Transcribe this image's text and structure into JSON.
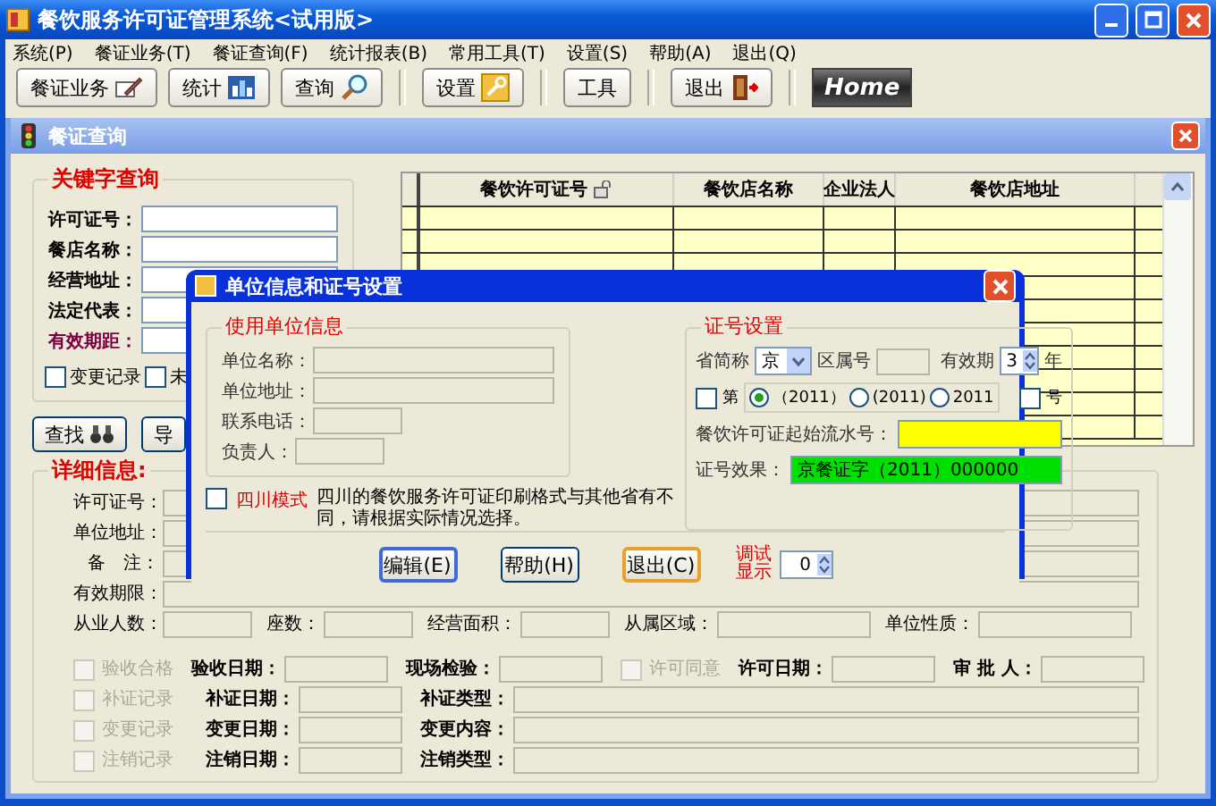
{
  "window": {
    "title": "餐饮服务许可证管理系统<试用版>"
  },
  "menu": [
    "系统(P)",
    "餐证业务(T)",
    "餐证查询(F)",
    "统计报表(B)",
    "常用工具(T)",
    "设置(S)",
    "帮助(A)",
    "退出(Q)"
  ],
  "toolbar": [
    {
      "label": "餐证业务",
      "kind": "edit"
    },
    {
      "label": "统计",
      "kind": "chart"
    },
    {
      "label": "查询",
      "kind": "search"
    },
    {
      "label": "设置",
      "kind": "settings"
    },
    {
      "label": "工具",
      "kind": "plain"
    },
    {
      "label": "退出",
      "kind": "exit"
    },
    {
      "label": "Home",
      "kind": "logo"
    }
  ],
  "query_window": {
    "title": "餐证查询",
    "keyword_group": {
      "title": "关键字查询",
      "fields": [
        {
          "label": "许可证号：",
          "kind": "normal"
        },
        {
          "label": "餐店名称：",
          "kind": "normal"
        },
        {
          "label": "经营地址：",
          "kind": "normal"
        },
        {
          "label": "法定代表：",
          "kind": "normal"
        },
        {
          "label": "有效期距：",
          "kind": "accent"
        }
      ],
      "checkboxes": [
        {
          "label": "变更记录",
          "checked": false
        },
        {
          "label": "未",
          "checked": false
        }
      ],
      "buttons": [
        {
          "label": "查找",
          "kind": "find"
        },
        {
          "label": "导",
          "kind": "plain"
        }
      ]
    },
    "results_table": {
      "columns": [
        {
          "label": "餐饮许可证号",
          "kind": "icon"
        },
        {
          "label": "餐饮店名称",
          "kind": "plain"
        },
        {
          "label": "企业法人",
          "kind": "plain"
        },
        {
          "label": "餐饮店地址",
          "kind": "plain"
        }
      ]
    },
    "detail_group": {
      "title": "详细信息:",
      "rows": [
        {
          "fields": [
            {
              "label": "许可证号：",
              "kind": "wide"
            }
          ]
        },
        {
          "fields": [
            {
              "label": "单位地址：",
              "kind": "wide"
            }
          ]
        },
        {
          "fields": [
            {
              "label": "备　注：",
              "kind": "wide"
            }
          ]
        },
        {
          "fields": [
            {
              "label": "有效期限：",
              "kind": "wide"
            }
          ]
        },
        {
          "fields": [
            {
              "label": "从业人数：",
              "kind": "small"
            },
            {
              "label": "座数：",
              "kind": "small"
            },
            {
              "label": "经营面积：",
              "kind": "small"
            },
            {
              "label": "从属区域：",
              "kind": "medium"
            },
            {
              "label": "单位性质：",
              "kind": "medium"
            }
          ]
        }
      ],
      "record_rows": [
        {
          "items": [
            {
              "kind": "checkbox",
              "label": "验收合格",
              "checked": false,
              "disabled": true
            },
            {
              "kind": "field",
              "label": "验收日期："
            },
            {
              "kind": "field",
              "label": "现场检验："
            },
            {
              "kind": "checkbox",
              "label": "许可同意",
              "checked": false,
              "disabled": true
            },
            {
              "kind": "field",
              "label": "许可日期："
            },
            {
              "kind": "field",
              "label": "审 批 人："
            }
          ]
        },
        {
          "items": [
            {
              "kind": "checkbox",
              "label": "补证记录",
              "checked": false,
              "disabled": true
            },
            {
              "kind": "field",
              "label": "补证日期："
            },
            {
              "kind": "wide",
              "label": "补证类型："
            }
          ]
        },
        {
          "items": [
            {
              "kind": "checkbox",
              "label": "变更记录",
              "checked": false,
              "disabled": true
            },
            {
              "kind": "field",
              "label": "变更日期："
            },
            {
              "kind": "wide",
              "label": "变更内容："
            }
          ]
        },
        {
          "items": [
            {
              "kind": "checkbox",
              "label": "注销记录",
              "checked": false,
              "disabled": true
            },
            {
              "kind": "field",
              "label": "注销日期："
            },
            {
              "kind": "wide",
              "label": "注销类型："
            }
          ]
        }
      ]
    }
  },
  "dialog": {
    "title": "单位信息和证号设置",
    "unit_group": {
      "title": "使用单位信息",
      "fields": [
        {
          "label": "单位名称：",
          "kind": "wide"
        },
        {
          "label": "单位地址：",
          "kind": "wide"
        },
        {
          "label": "联系电话：",
          "kind": "short"
        },
        {
          "label": "负责人：",
          "kind": "short"
        }
      ]
    },
    "number_group": {
      "title": "证号设置",
      "province_label": "省简称",
      "province": "京",
      "district_label": "区属号",
      "validity_label": "有效期",
      "validity": "3",
      "validity_unit": "年",
      "prefix_checkbox": {
        "label": "第",
        "checked": false
      },
      "formats": [
        {
          "label": "（2011）",
          "selected": true
        },
        {
          "label": "(2011)",
          "selected": false
        },
        {
          "label": "2011",
          "selected": false
        }
      ],
      "suffix_checkbox": {
        "label": "号",
        "checked": false
      },
      "serial_label": "餐饮许可证起始流水号：",
      "preview_label": "证号效果：",
      "preview": "京餐证字（2011）000000"
    },
    "sichuan_mode": {
      "label": "四川模式",
      "checked": false,
      "note": "四川的餐饮服务许可证印刷格式与其他省有不同，请根据实际情况选择。"
    },
    "buttons": [
      {
        "label": "编辑(E)",
        "kind": "focused"
      },
      {
        "label": "帮助(H)",
        "kind": "normal"
      },
      {
        "label": "退出(C)",
        "kind": "hot"
      }
    ],
    "debug_label": "调试显示",
    "debug_value": "0"
  }
}
